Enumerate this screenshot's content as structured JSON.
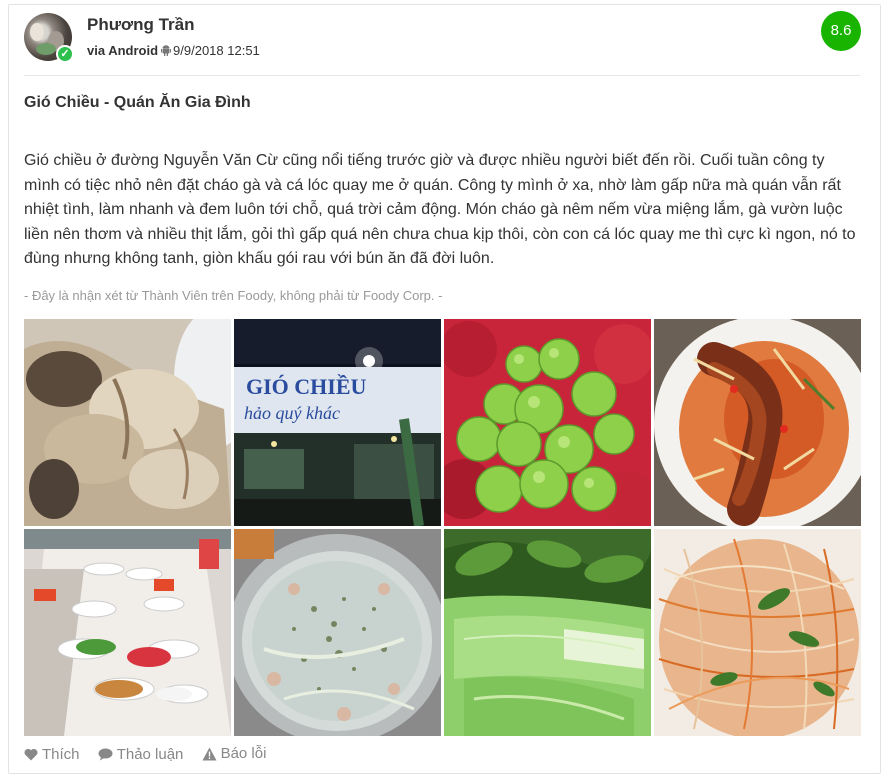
{
  "user": {
    "name": "Phương Trần",
    "via": "via Android",
    "datetime": "9/9/2018 12:51"
  },
  "score": "8.6",
  "colors": {
    "score_bg": "#18b400",
    "verified": "#2ec04d"
  },
  "review": {
    "title": "Gió Chiều - Quán Ăn Gia Đình",
    "body": "Gió chiều ở đường Nguyễn Văn Cừ cũng nổi tiếng trước giờ và được nhiều người biết đến rồi. Cuối tuần công ty mình có tiệc nhỏ nên đặt cháo gà và cá lóc quay me ở quán. Công ty mình ở xa, nhờ làm gấp nữa mà quán vẫn rất nhiệt tình, làm nhanh và đem luôn tới chỗ, quá trời cảm động. Món cháo gà nêm nếm vừa miệng lắm, gà vườn luộc liền nên thơm và nhiều thịt lắm, gỏi thì gấp quá nên chưa chua kịp thôi, còn con cá lóc quay me thì cực kì ngon, nó to đùng nhưng không tanh, giòn khấu gói rau với bún ăn đã đời luôn.",
    "disclaimer": "- Đây là nhận xét từ Thành Viên trên Foody, không phải từ Foody Corp. -"
  },
  "photos": [
    {
      "name": "photo-boiled-chicken"
    },
    {
      "name": "photo-restaurant-sign",
      "sign_text": "GIÓ CHIỀU",
      "sign_sub": "hảo quý khác"
    },
    {
      "name": "photo-fruits"
    },
    {
      "name": "photo-tamarind-fish"
    },
    {
      "name": "photo-party-tables"
    },
    {
      "name": "photo-chicken-porridge"
    },
    {
      "name": "photo-herbs"
    },
    {
      "name": "photo-salad"
    }
  ],
  "actions": {
    "like": "Thích",
    "discuss": "Thảo luận",
    "report": "Báo lỗi"
  }
}
